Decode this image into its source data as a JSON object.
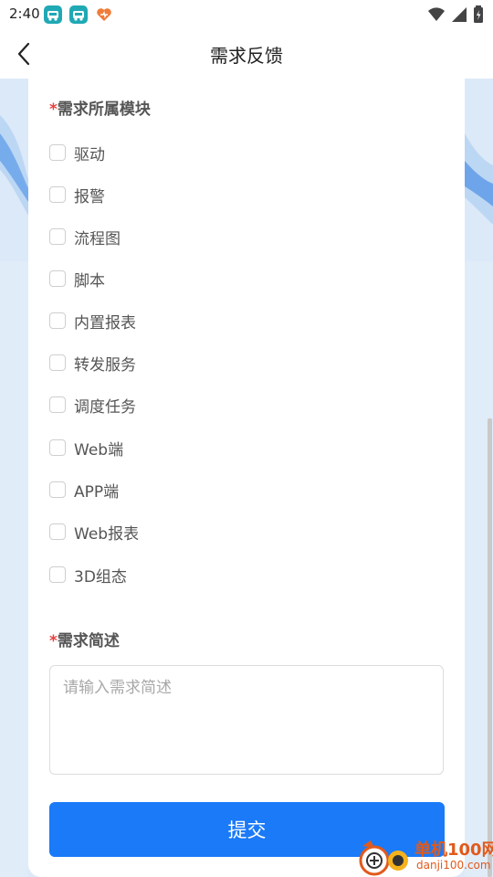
{
  "status_bar": {
    "time": "2:40",
    "app_icons": [
      "car-app-icon",
      "car-app-icon",
      "heart-app-icon"
    ],
    "right_icons": [
      "wifi-icon",
      "signal-icon",
      "battery-icon"
    ]
  },
  "header": {
    "back_icon": "chevron-left-icon",
    "title": "需求反馈"
  },
  "form": {
    "module_section": {
      "required_mark": "*",
      "label": "需求所属模块",
      "options": [
        {
          "label": "驱动",
          "checked": false
        },
        {
          "label": "报警",
          "checked": false
        },
        {
          "label": "流程图",
          "checked": false
        },
        {
          "label": "脚本",
          "checked": false
        },
        {
          "label": "内置报表",
          "checked": false
        },
        {
          "label": "转发服务",
          "checked": false
        },
        {
          "label": "调度任务",
          "checked": false
        },
        {
          "label": "Web端",
          "checked": false
        },
        {
          "label": "APP端",
          "checked": false
        },
        {
          "label": "Web报表",
          "checked": false
        },
        {
          "label": "3D组态",
          "checked": false
        }
      ]
    },
    "description_section": {
      "required_mark": "*",
      "label": "需求简述",
      "placeholder": "请输入需求简述",
      "value": ""
    },
    "submit_label": "提交"
  },
  "watermark": {
    "text_cn": "单机100网",
    "text_en": "danji100.com"
  },
  "colors": {
    "accent": "#1a7af8",
    "required": "#e8413f",
    "background": "#dce9f8",
    "watermark": "#e05a1c"
  }
}
